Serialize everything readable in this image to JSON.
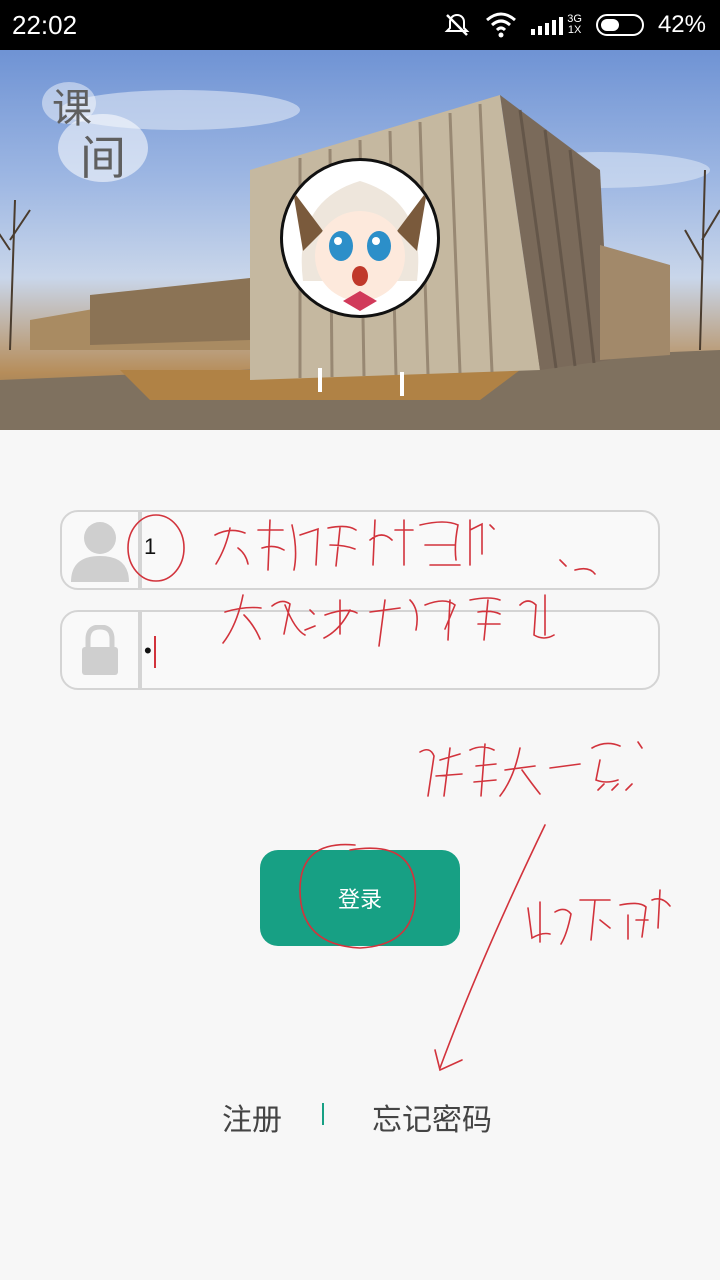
{
  "status_bar": {
    "time": "22:02",
    "network_top": "3G",
    "network_bottom": "1X",
    "battery": "42%"
  },
  "header": {
    "logo_char_1": "课",
    "logo_char_2": "间"
  },
  "form": {
    "username_value": "1",
    "password_value": "•"
  },
  "buttons": {
    "login": "登录"
  },
  "links": {
    "register": "注册",
    "forgot_password": "忘记密码"
  },
  "colors": {
    "accent": "#17a084",
    "annotation": "#d2333c"
  },
  "icons": [
    "mute-icon",
    "wifi-icon",
    "signal-icon",
    "battery-icon",
    "user-icon",
    "lock-icon"
  ]
}
